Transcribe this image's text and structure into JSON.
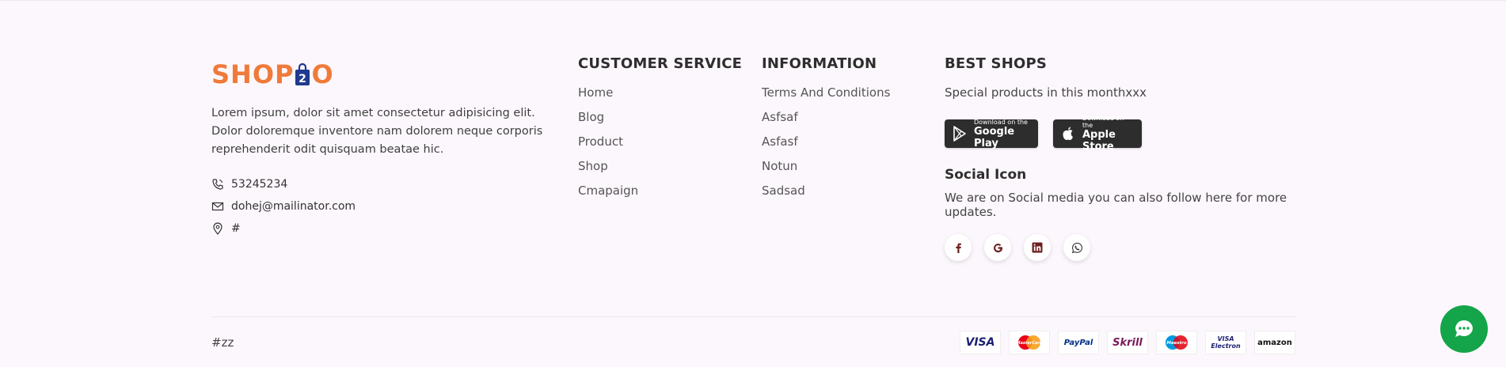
{
  "brand": {
    "logo_left": "SHOP",
    "logo_right": "O",
    "about": "Lorem ipsum, dolor sit amet consectetur adipisicing elit. Dolor doloremque inventore nam dolorem neque corporis reprehenderit odit quisquam beatae hic.",
    "phone": "53245234",
    "email": "dohej@mailinator.com",
    "address": "#"
  },
  "customer_service": {
    "title": "CUSTOMER SERVICE",
    "links": [
      "Home",
      "Blog",
      "Product",
      "Shop",
      "Cmapaign"
    ]
  },
  "information": {
    "title": "INFORMATION",
    "links": [
      "Terms And Conditions",
      "Asfsaf",
      "Asfasf",
      "Notun",
      "Sadsad"
    ]
  },
  "best_shops": {
    "title": "BEST SHOPS",
    "subtitle": "Special products in this monthxxx",
    "google_play": {
      "small": "Download on the",
      "big": "Google Play"
    },
    "apple_store": {
      "small": "Download on the",
      "big": "Apple Store"
    }
  },
  "social": {
    "title": "Social Icon",
    "text": "We are on Social media you can also follow here for more updates.",
    "icons": [
      "facebook-icon",
      "google-icon",
      "linkedin-icon",
      "whatsapp-icon"
    ]
  },
  "bottom": {
    "copyright": "#zz",
    "payments": [
      "VISA",
      "MasterCard",
      "PayPal",
      "Skrill",
      "Maestro",
      "VISA Electron",
      "amazon"
    ]
  },
  "colors": {
    "brand_orange": "#f07a3a",
    "brand_blue": "#1f3a8f",
    "background": "#fcf7fc",
    "chat_green": "#14a54a"
  }
}
